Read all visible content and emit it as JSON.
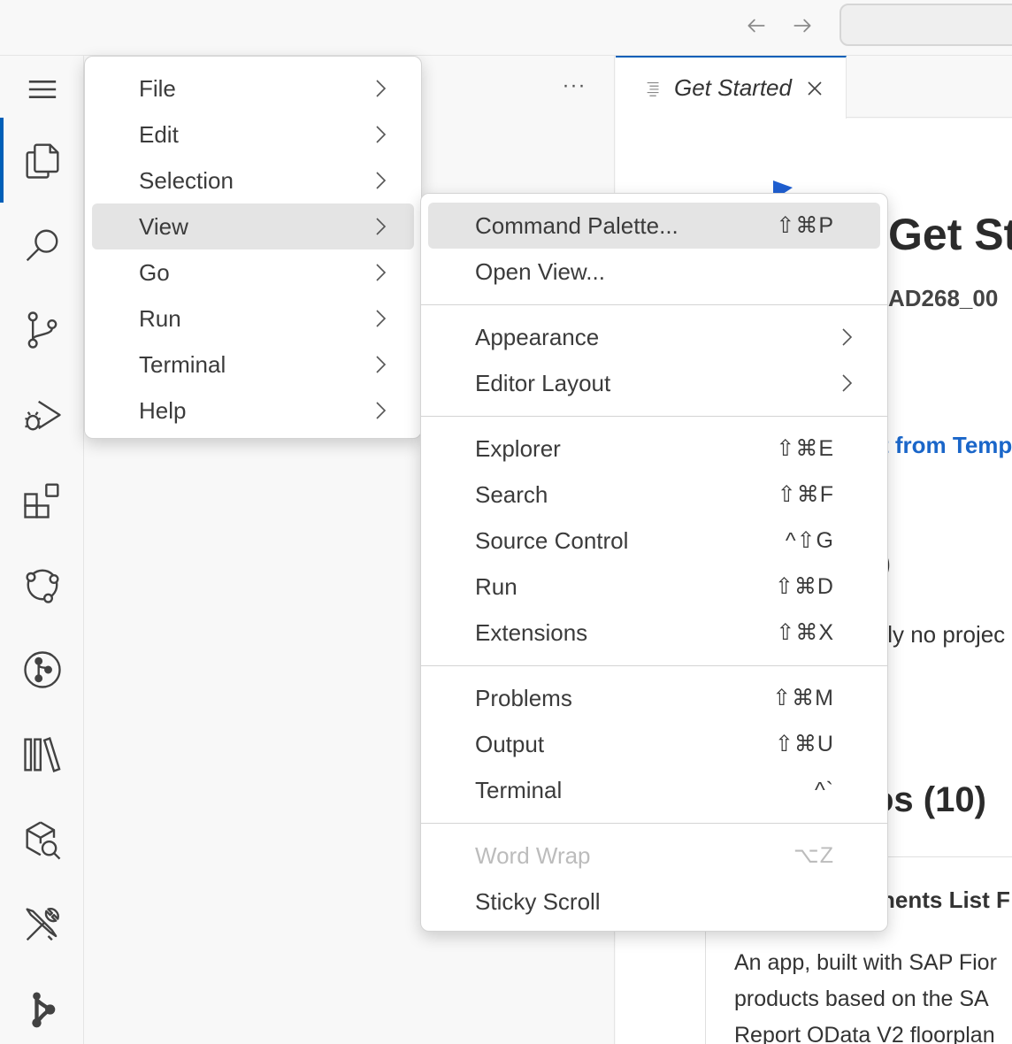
{
  "main_menu": {
    "items": [
      {
        "label": "File"
      },
      {
        "label": "Edit"
      },
      {
        "label": "Selection"
      },
      {
        "label": "View"
      },
      {
        "label": "Go"
      },
      {
        "label": "Run"
      },
      {
        "label": "Terminal"
      },
      {
        "label": "Help"
      }
    ],
    "highlighted": "View"
  },
  "view_menu": {
    "groups": [
      [
        {
          "label": "Command Palette...",
          "shortcut": "⇧⌘P"
        },
        {
          "label": "Open View...",
          "shortcut": ""
        }
      ],
      [
        {
          "label": "Appearance",
          "shortcut": ""
        },
        {
          "label": "Editor Layout",
          "shortcut": ""
        }
      ],
      [
        {
          "label": "Explorer",
          "shortcut": "⇧⌘E"
        },
        {
          "label": "Search",
          "shortcut": "⇧⌘F"
        },
        {
          "label": "Source Control",
          "shortcut": "^⇧G"
        },
        {
          "label": "Run",
          "shortcut": "⇧⌘D"
        },
        {
          "label": "Extensions",
          "shortcut": "⇧⌘X"
        }
      ],
      [
        {
          "label": "Problems",
          "shortcut": "⇧⌘M"
        },
        {
          "label": "Output",
          "shortcut": "⇧⌘U"
        },
        {
          "label": "Terminal",
          "shortcut": "^`"
        }
      ],
      [
        {
          "label": "Word Wrap",
          "shortcut": "⌥Z",
          "disabled": true
        },
        {
          "label": "Sticky Scroll",
          "shortcut": ""
        }
      ]
    ],
    "highlighted": "Command Palette..."
  },
  "editor": {
    "tab_title": "Get Started",
    "title_fragment": "Get St",
    "subtitle_fragment": "AD268_00",
    "link_fragment": "t from Temp",
    "paren_fragment": ")",
    "noproj_fragment": "tly no projec",
    "samples_fragment": "os (10)",
    "card_title_fragment": "nents List F",
    "card_desc": "An app, built with SAP Fior products based on the SA Report OData V2 floorplan"
  },
  "colors": {
    "accent": "#005fb8",
    "link": "#1a66c9",
    "menu_highlight": "#e4e4e4"
  }
}
